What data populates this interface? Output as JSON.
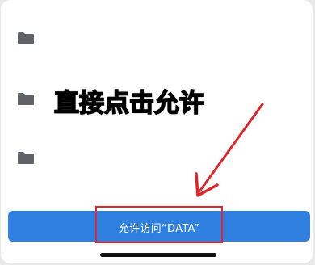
{
  "folders": [
    {
      "icon": "folder-icon"
    },
    {
      "icon": "folder-icon"
    },
    {
      "icon": "folder-icon"
    }
  ],
  "annotation": {
    "text": "直接点击允许",
    "text_color": "#e8d84f",
    "outline_color": "#000000",
    "arrow_color": "#e1252a"
  },
  "allow_button": {
    "label": "允许访问“DATA”",
    "bg_color": "#2f7fe0",
    "text_color": "#ffffff"
  },
  "highlight": {
    "color": "#e1252a"
  }
}
